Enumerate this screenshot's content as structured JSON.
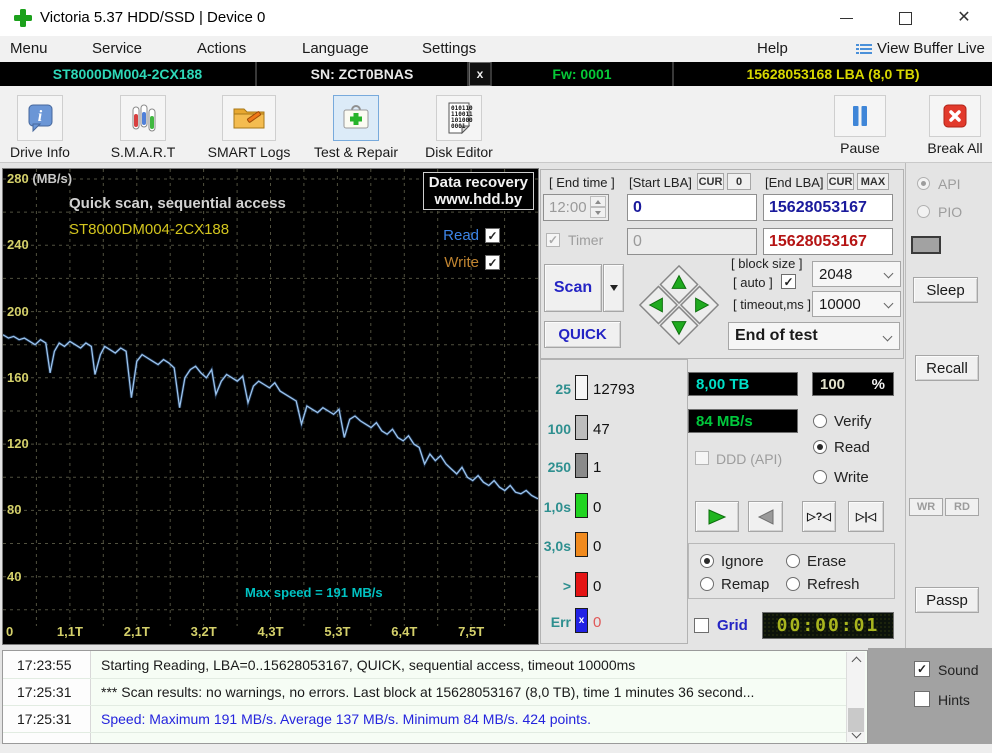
{
  "window": {
    "title": "Victoria 5.37 HDD/SSD | Device 0"
  },
  "menubar": {
    "items": [
      "Menu",
      "Service",
      "Actions",
      "Language",
      "Settings"
    ],
    "help": "Help",
    "view_buffer_live": "View Buffer Live"
  },
  "device_bar": {
    "model": "ST8000DM004-2CX188",
    "serial": "SN: ZCT0BNAS",
    "close_x": "x",
    "firmware": "Fw: 0001",
    "capacity_lba": "15628053168 LBA (8,0 TB)"
  },
  "toolbar": {
    "drive_info": "Drive Info",
    "smart": "S.M.A.R.T",
    "smart_logs": "SMART Logs",
    "test_repair": "Test & Repair",
    "disk_editor": "Disk Editor",
    "pause": "Pause",
    "break_all": "Break All"
  },
  "graph": {
    "title": "Quick scan, sequential access",
    "model": "ST8000DM004-2CX188",
    "watermark1": "Data recovery",
    "watermark2": "www.hdd.by",
    "read_label": "Read",
    "write_label": "Write",
    "max_speed_note": "Max speed = 191 MB/s"
  },
  "chart_data": {
    "type": "line",
    "title": "Quick scan, sequential access",
    "series_name": "Read speed",
    "x_labels": [
      "0",
      "1,1T",
      "2,1T",
      "3,2T",
      "4,3T",
      "5,3T",
      "6,4T",
      "7,5T"
    ],
    "y_ticks": [
      280,
      240,
      200,
      160,
      120,
      80,
      40
    ],
    "y_unit": "(MB/s)",
    "ylim": [
      0,
      280
    ],
    "max_speed_mbs": 191,
    "avg_speed_mbs": 137,
    "min_speed_mbs": 84,
    "points": [
      [
        0,
        186
      ],
      [
        0.01,
        184
      ],
      [
        0.02,
        185
      ],
      [
        0.03,
        183
      ],
      [
        0.04,
        184
      ],
      [
        0.05,
        182
      ],
      [
        0.06,
        180
      ],
      [
        0.07,
        183
      ],
      [
        0.08,
        181
      ],
      [
        0.088,
        163
      ],
      [
        0.096,
        176
      ],
      [
        0.105,
        181
      ],
      [
        0.115,
        179
      ],
      [
        0.125,
        182
      ],
      [
        0.135,
        180
      ],
      [
        0.145,
        178
      ],
      [
        0.155,
        181
      ],
      [
        0.165,
        179
      ],
      [
        0.172,
        162
      ],
      [
        0.182,
        174
      ],
      [
        0.19,
        179
      ],
      [
        0.2,
        177
      ],
      [
        0.21,
        175
      ],
      [
        0.22,
        178
      ],
      [
        0.23,
        176
      ],
      [
        0.24,
        148
      ],
      [
        0.25,
        170
      ],
      [
        0.26,
        174
      ],
      [
        0.27,
        172
      ],
      [
        0.28,
        170
      ],
      [
        0.29,
        168
      ],
      [
        0.3,
        171
      ],
      [
        0.31,
        169
      ],
      [
        0.32,
        166
      ],
      [
        0.33,
        142
      ],
      [
        0.34,
        160
      ],
      [
        0.35,
        165
      ],
      [
        0.36,
        167
      ],
      [
        0.37,
        163
      ],
      [
        0.38,
        160
      ],
      [
        0.39,
        165
      ],
      [
        0.398,
        150
      ],
      [
        0.408,
        158
      ],
      [
        0.418,
        162
      ],
      [
        0.428,
        160
      ],
      [
        0.438,
        158
      ],
      [
        0.448,
        161
      ],
      [
        0.458,
        145
      ],
      [
        0.468,
        155
      ],
      [
        0.478,
        158
      ],
      [
        0.488,
        156
      ],
      [
        0.498,
        154
      ],
      [
        0.508,
        157
      ],
      [
        0.518,
        152
      ],
      [
        0.528,
        150
      ],
      [
        0.538,
        148
      ],
      [
        0.548,
        146
      ],
      [
        0.558,
        132
      ],
      [
        0.568,
        143
      ],
      [
        0.578,
        141
      ],
      [
        0.588,
        139
      ],
      [
        0.598,
        142
      ],
      [
        0.608,
        140
      ],
      [
        0.618,
        138
      ],
      [
        0.628,
        141
      ],
      [
        0.638,
        124
      ],
      [
        0.648,
        135
      ],
      [
        0.658,
        137
      ],
      [
        0.668,
        134
      ],
      [
        0.678,
        132
      ],
      [
        0.688,
        130
      ],
      [
        0.698,
        133
      ],
      [
        0.708,
        128
      ],
      [
        0.718,
        126
      ],
      [
        0.728,
        129
      ],
      [
        0.738,
        124
      ],
      [
        0.748,
        122
      ],
      [
        0.758,
        125
      ],
      [
        0.768,
        120
      ],
      [
        0.778,
        118
      ],
      [
        0.788,
        108
      ],
      [
        0.798,
        114
      ],
      [
        0.808,
        110
      ],
      [
        0.818,
        113
      ],
      [
        0.828,
        108
      ],
      [
        0.838,
        105
      ],
      [
        0.848,
        102
      ],
      [
        0.858,
        106
      ],
      [
        0.868,
        100
      ],
      [
        0.878,
        98
      ],
      [
        0.888,
        101
      ],
      [
        0.898,
        97
      ],
      [
        0.908,
        95
      ],
      [
        0.918,
        98
      ],
      [
        0.928,
        94
      ],
      [
        0.938,
        92
      ],
      [
        0.948,
        95
      ],
      [
        0.958,
        91
      ],
      [
        0.968,
        90
      ],
      [
        0.978,
        92
      ],
      [
        0.988,
        89
      ],
      [
        1,
        87
      ]
    ]
  },
  "test_controls": {
    "end_time_label": "[ End time ]",
    "end_time_value": "12:00",
    "timer_label": "Timer",
    "timer_field_value": "0",
    "start_lba_label": "[Start LBA]",
    "cur_button": "CUR",
    "zero_button": "0",
    "start_lba_value": "0",
    "end_lba_label": "[End LBA]",
    "max_button": "MAX",
    "end_lba_value": "15628053167",
    "end_lba_current": "15628053167",
    "scan_button": "Scan",
    "quick_button": "QUICK",
    "block_size_label": "[ block size ]",
    "auto_label": "[ auto ]",
    "block_size_value": "2048",
    "timeout_label": "[ timeout,ms ]",
    "timeout_value": "10000",
    "end_of_test_value": "End of test"
  },
  "block_stats": {
    "rows": [
      {
        "label": "25",
        "count": "12793",
        "color": "#f5f5f5"
      },
      {
        "label": "100",
        "count": "47",
        "color": "#bdbdbd"
      },
      {
        "label": "250",
        "count": "1",
        "color": "#8a8a8a"
      },
      {
        "label": "1,0s",
        "count": "0",
        "color": "#21d421"
      },
      {
        "label": "3,0s",
        "count": "0",
        "color": "#f08a1e"
      },
      {
        "label": ">",
        "count": "0",
        "color": "#e41414"
      },
      {
        "label": "Err",
        "count": "0",
        "color": "#2121e4",
        "err_x": "x"
      }
    ]
  },
  "status": {
    "capacity": "8,00 TB",
    "progress_value": "100",
    "progress_unit": "%",
    "speed": "84 MB/s",
    "ddd_label": "DDD (API)",
    "mode_verify": "Verify",
    "mode_read": "Read",
    "mode_write": "Write"
  },
  "defects": {
    "ignore": "Ignore",
    "erase": "Erase",
    "remap": "Remap",
    "refresh": "Refresh",
    "grid_label": "Grid",
    "elapsed": "00:00:01"
  },
  "side_panel": {
    "api": "API",
    "pio": "PIO",
    "sleep": "Sleep",
    "recall": "Recall",
    "wr": "WR",
    "rd": "RD",
    "passp": "Passp"
  },
  "log": {
    "rows": [
      {
        "time": "17:23:55",
        "text": "Starting Reading, LBA=0..15628053167, QUICK, sequential access, timeout 10000ms",
        "color": "#1a1a1a"
      },
      {
        "time": "17:25:31",
        "text": "*** Scan results: no warnings, no errors. Last block at 15628053167 (8,0 TB), time 1 minutes 36 second...",
        "color": "#1a1a1a"
      },
      {
        "time": "17:25:31",
        "text": "Speed: Maximum 191 MB/s. Average 137 MB/s. Minimum 84 MB/s. 424 points.",
        "color": "#2424dd"
      }
    ],
    "sound_label": "Sound",
    "hints_label": "Hints"
  }
}
